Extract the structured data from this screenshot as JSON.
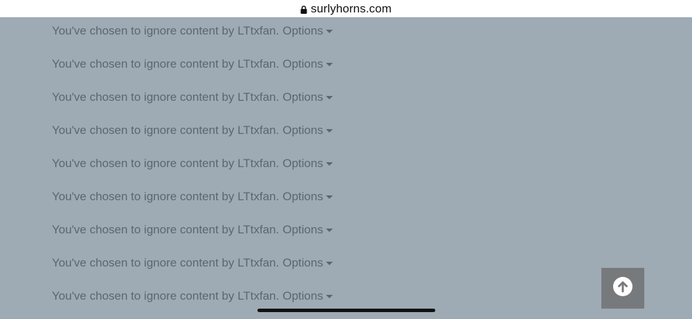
{
  "browser": {
    "url": "surlyhorns.com",
    "lock_icon": "lock-icon"
  },
  "ignored_posts": [
    {
      "message": "You've chosen to ignore content by LTtxfan.",
      "options_label": "Options"
    },
    {
      "message": "You've chosen to ignore content by LTtxfan.",
      "options_label": "Options"
    },
    {
      "message": "You've chosen to ignore content by LTtxfan.",
      "options_label": "Options"
    },
    {
      "message": "You've chosen to ignore content by LTtxfan.",
      "options_label": "Options"
    },
    {
      "message": "You've chosen to ignore content by LTtxfan.",
      "options_label": "Options"
    },
    {
      "message": "You've chosen to ignore content by LTtxfan.",
      "options_label": "Options"
    },
    {
      "message": "You've chosen to ignore content by LTtxfan.",
      "options_label": "Options"
    },
    {
      "message": "You've chosen to ignore content by LTtxfan.",
      "options_label": "Options"
    },
    {
      "message": "You've chosen to ignore content by LTtxfan.",
      "options_label": "Options"
    }
  ],
  "scroll_top": {
    "icon": "arrow-up-circle-icon"
  },
  "colors": {
    "page_background": "#9eaab4",
    "text": "#5c6670",
    "scroll_button": "#777a7d"
  }
}
